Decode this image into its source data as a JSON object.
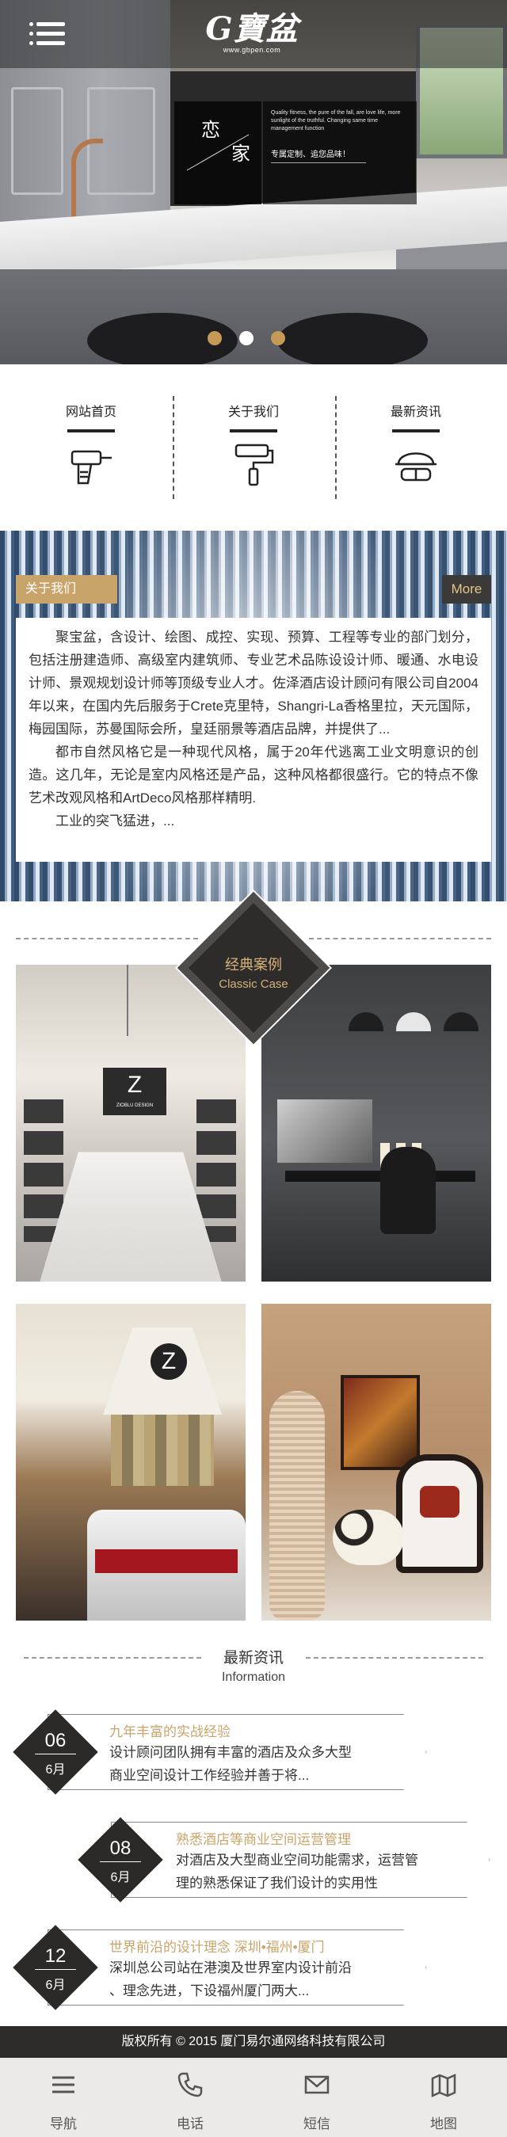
{
  "header": {
    "logo_text": "G寶盆",
    "logo_url": "www.gbpen.com",
    "menu_icon": "menu-icon"
  },
  "banner": {
    "word1": "恋",
    "word2": "家",
    "copy_en": "Quality fitness, the pure of the fall, are love life, more sunlight of the truthful. Changing same time management function",
    "slogan": "专属定制、追您品味！",
    "slides": 3,
    "active_slide": 2
  },
  "quick_nav": [
    {
      "label": "网站首页",
      "icon": "drill-icon"
    },
    {
      "label": "关于我们",
      "icon": "paint-roller-icon"
    },
    {
      "label": "最新资讯",
      "icon": "safety-helmet-icon"
    }
  ],
  "about": {
    "tab_label": "关于我们",
    "more_label": "More",
    "paragraphs": [
      "聚宝盆，含设计、绘图、成控、实现、预算、工程等专业的部门划分，包括注册建造师、高级室内建筑师、专业艺术品陈设设计师、暖通、水电设计师、景观规划设计师等顶级专业人才。佐泽酒店设计顾问有限公司自2004年以来，在国内先后服务于Crete克里特，Shangri-La香格里拉，天元国际，梅园国际，苏曼国际会所，皇廷丽景等酒店品牌，并提供了...",
      "都市自然风格它是一种现代风格，属于20年代逃离工业文明意识的创造。这几年，无论是室内风格还是产品，这种风格都很盛行。它的特点不像艺术改观风格和ArtDeco风格那样精明.",
      "工业的突飞猛进，..."
    ]
  },
  "cases": {
    "title_cn": "经典案例",
    "title_en": "Classic Case",
    "photos": [
      {
        "alt": "conference-room-photo",
        "screen_letter": "Z",
        "screen_caption": "ZIOBLU DESIGN"
      },
      {
        "alt": "dining-room-photo"
      },
      {
        "alt": "kitchen-photo",
        "mark": "Z"
      },
      {
        "alt": "living-room-photo"
      }
    ]
  },
  "news": {
    "title_cn": "最新资讯",
    "title_en": "Information",
    "items": [
      {
        "day": "06",
        "month": "6月",
        "title": "九年丰富的实战经验",
        "desc1": "设计顾问团队拥有丰富的酒店及众多大型",
        "desc2": "商业空间设计工作经验并善于将..."
      },
      {
        "day": "08",
        "month": "6月",
        "title": "熟悉酒店等商业空间运营管理",
        "desc1": "对酒店及大型商业空间功能需求，运营管",
        "desc2": "理的熟悉保证了我们设计的实用性"
      },
      {
        "day": "12",
        "month": "6月",
        "title": "世界前沿的设计理念 深圳•福州•厦门",
        "desc1": "深圳总公司站在港澳及世界室内设计前沿",
        "desc2": "、理念先进，下设福州厦门两大..."
      }
    ]
  },
  "footer": {
    "copyright": "版权所有 © 2015 厦门易尔通网络科技有限公司"
  },
  "bottom_nav": [
    {
      "label": "导航",
      "icon": "menu-bars-icon"
    },
    {
      "label": "电话",
      "icon": "phone-icon"
    },
    {
      "label": "短信",
      "icon": "envelope-icon"
    },
    {
      "label": "地图",
      "icon": "map-icon"
    }
  ],
  "colors": {
    "accent_gold": "#c9a46a",
    "dark": "#2e2c2b",
    "slider_dot": "#c49a56"
  }
}
